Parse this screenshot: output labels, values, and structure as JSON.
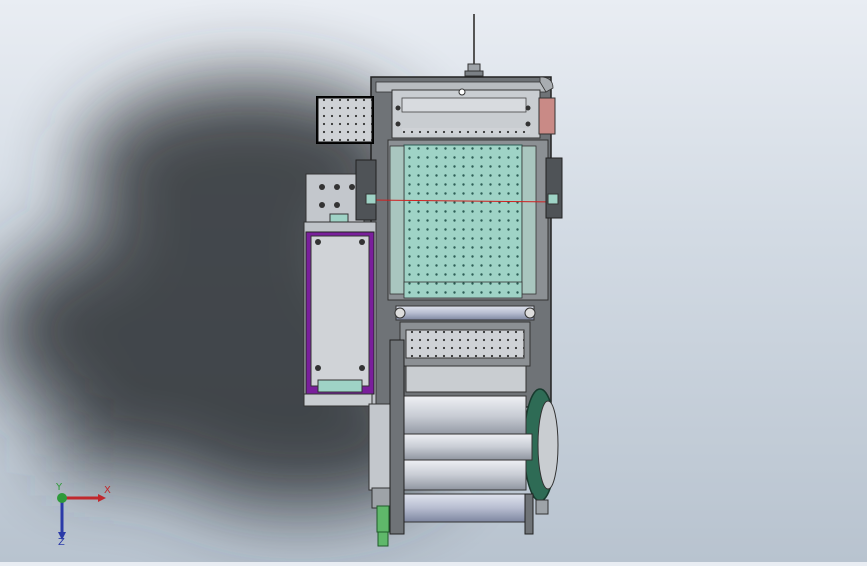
{
  "viewport": {
    "background_top": "#e9edf3",
    "background_bottom": "#b8c3cf",
    "shadow_color": "#2b2e33"
  },
  "model": {
    "frame_color": "#6f7377",
    "panel_color": "#c9cdd1",
    "grid_plate_color": "#9fd3c6",
    "purple_housing_color": "#7a1f9c",
    "green_wheel_color": "#2e6b55",
    "red_block_color": "#c98a86",
    "laser_line_color": "#d02020",
    "roller_color": "#c8ccd4",
    "cable_color": "#5fb86a"
  },
  "triad": {
    "x_label": "X",
    "y_label": "Y",
    "z_label": "Z",
    "x_color": "#c0282d",
    "y_color": "#2e9a3a",
    "z_color": "#2a3aa8"
  }
}
